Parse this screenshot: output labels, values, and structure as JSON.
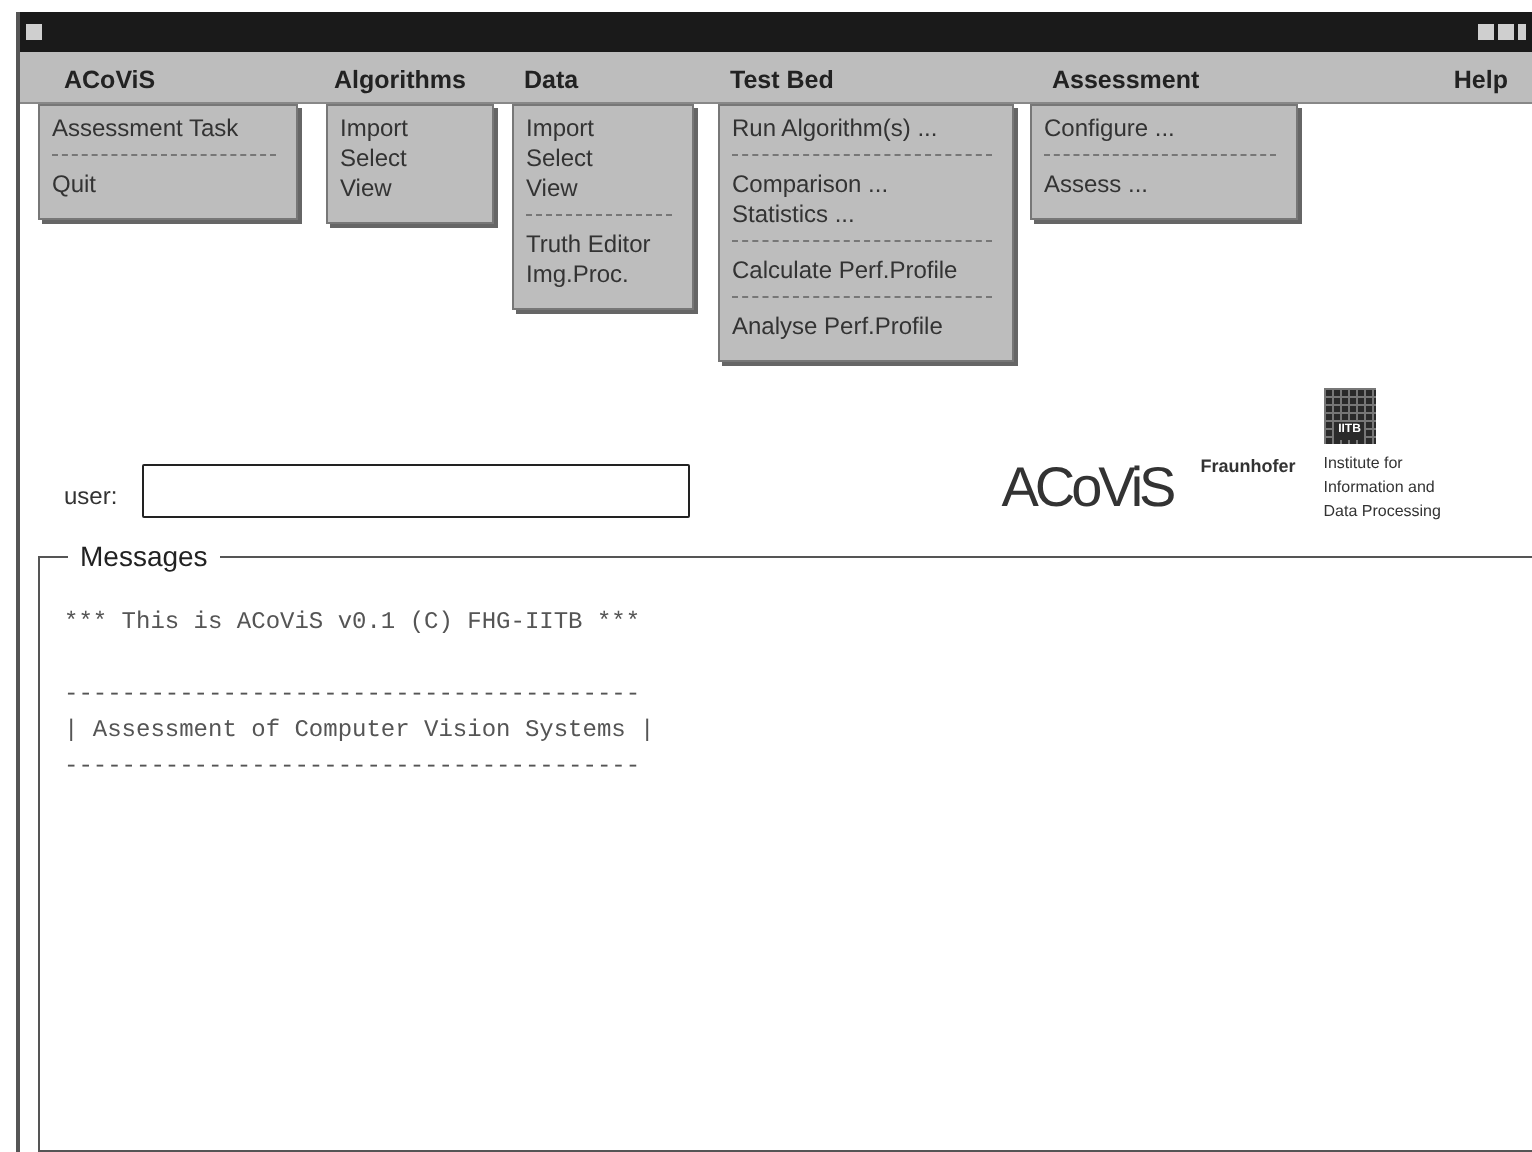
{
  "menu_bar": [
    {
      "label": "ACoViS",
      "menu": [
        {
          "kind": "item",
          "label": "Assessment Task"
        },
        {
          "kind": "separator"
        },
        {
          "kind": "item",
          "label": "Quit"
        }
      ]
    },
    {
      "label": "Algorithms",
      "menu": [
        {
          "kind": "item",
          "label": "Import"
        },
        {
          "kind": "item",
          "label": "Select"
        },
        {
          "kind": "item",
          "label": "View"
        }
      ]
    },
    {
      "label": "Data",
      "menu": [
        {
          "kind": "item",
          "label": "Import"
        },
        {
          "kind": "item",
          "label": "Select"
        },
        {
          "kind": "item",
          "label": "View"
        },
        {
          "kind": "separator"
        },
        {
          "kind": "item",
          "label": "Truth Editor"
        },
        {
          "kind": "item",
          "label": "Img.Proc."
        }
      ]
    },
    {
      "label": "Test Bed",
      "menu": [
        {
          "kind": "item",
          "label": "Run Algorithm(s) ..."
        },
        {
          "kind": "separator"
        },
        {
          "kind": "item",
          "label": "Comparison ..."
        },
        {
          "kind": "item",
          "label": "Statistics ..."
        },
        {
          "kind": "separator"
        },
        {
          "kind": "item",
          "label": "Calculate Perf.Profile"
        },
        {
          "kind": "separator"
        },
        {
          "kind": "item",
          "label": "Analyse Perf.Profile"
        }
      ]
    },
    {
      "label": "Assessment",
      "menu": [
        {
          "kind": "item",
          "label": "Configure ..."
        },
        {
          "kind": "separator"
        },
        {
          "kind": "item",
          "label": "Assess ..."
        }
      ]
    },
    {
      "label": "Help"
    }
  ],
  "user": {
    "label": "user:"
  },
  "branding": {
    "logo": "ACoViS",
    "org": "Fraunhofer",
    "badge": "IITB",
    "institute": [
      "Institute for",
      "Information and",
      "Data Processing"
    ]
  },
  "messages": {
    "title": "Messages",
    "lines": [
      "*** This is ACoViS v0.1 (C) FHG-IITB ***",
      "----------------------------------------",
      "| Assessment of Computer Vision Systems |",
      "----------------------------------------"
    ]
  }
}
